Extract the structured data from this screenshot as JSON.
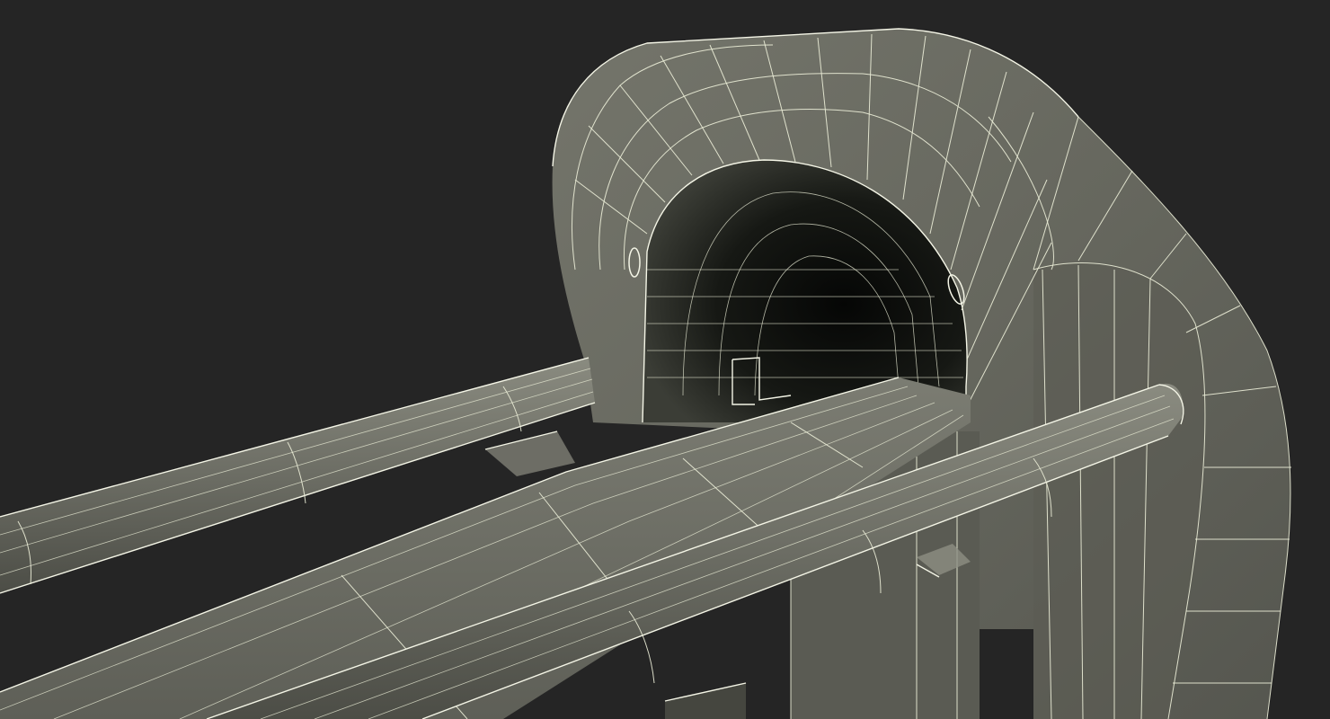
{
  "scene": {
    "subject": "mri-scanner-wireframe",
    "colors": {
      "background": "#252525",
      "surface": "#6a6b62",
      "surface_dark": "#4d4e47",
      "bore_inner": "#0e0f0d",
      "wireframe": "#e9ecd6"
    }
  }
}
